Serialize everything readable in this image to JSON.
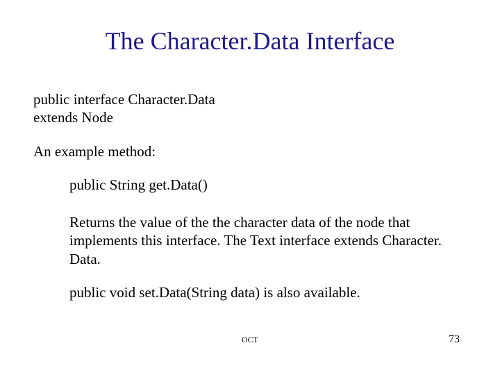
{
  "title": "The Character.Data Interface",
  "decl_line1": "public interface Character.Data",
  "decl_line2": "extends Node",
  "example_intro": "An example method:",
  "method_sig": "public String get.Data()",
  "method_desc": "Returns the value of the the character data of the node that implements this interface. The Text interface extends Character. Data.",
  "setdata_note": "public void  set.Data(String data) is also available.",
  "footer_label": "OCT",
  "page_number": "73"
}
